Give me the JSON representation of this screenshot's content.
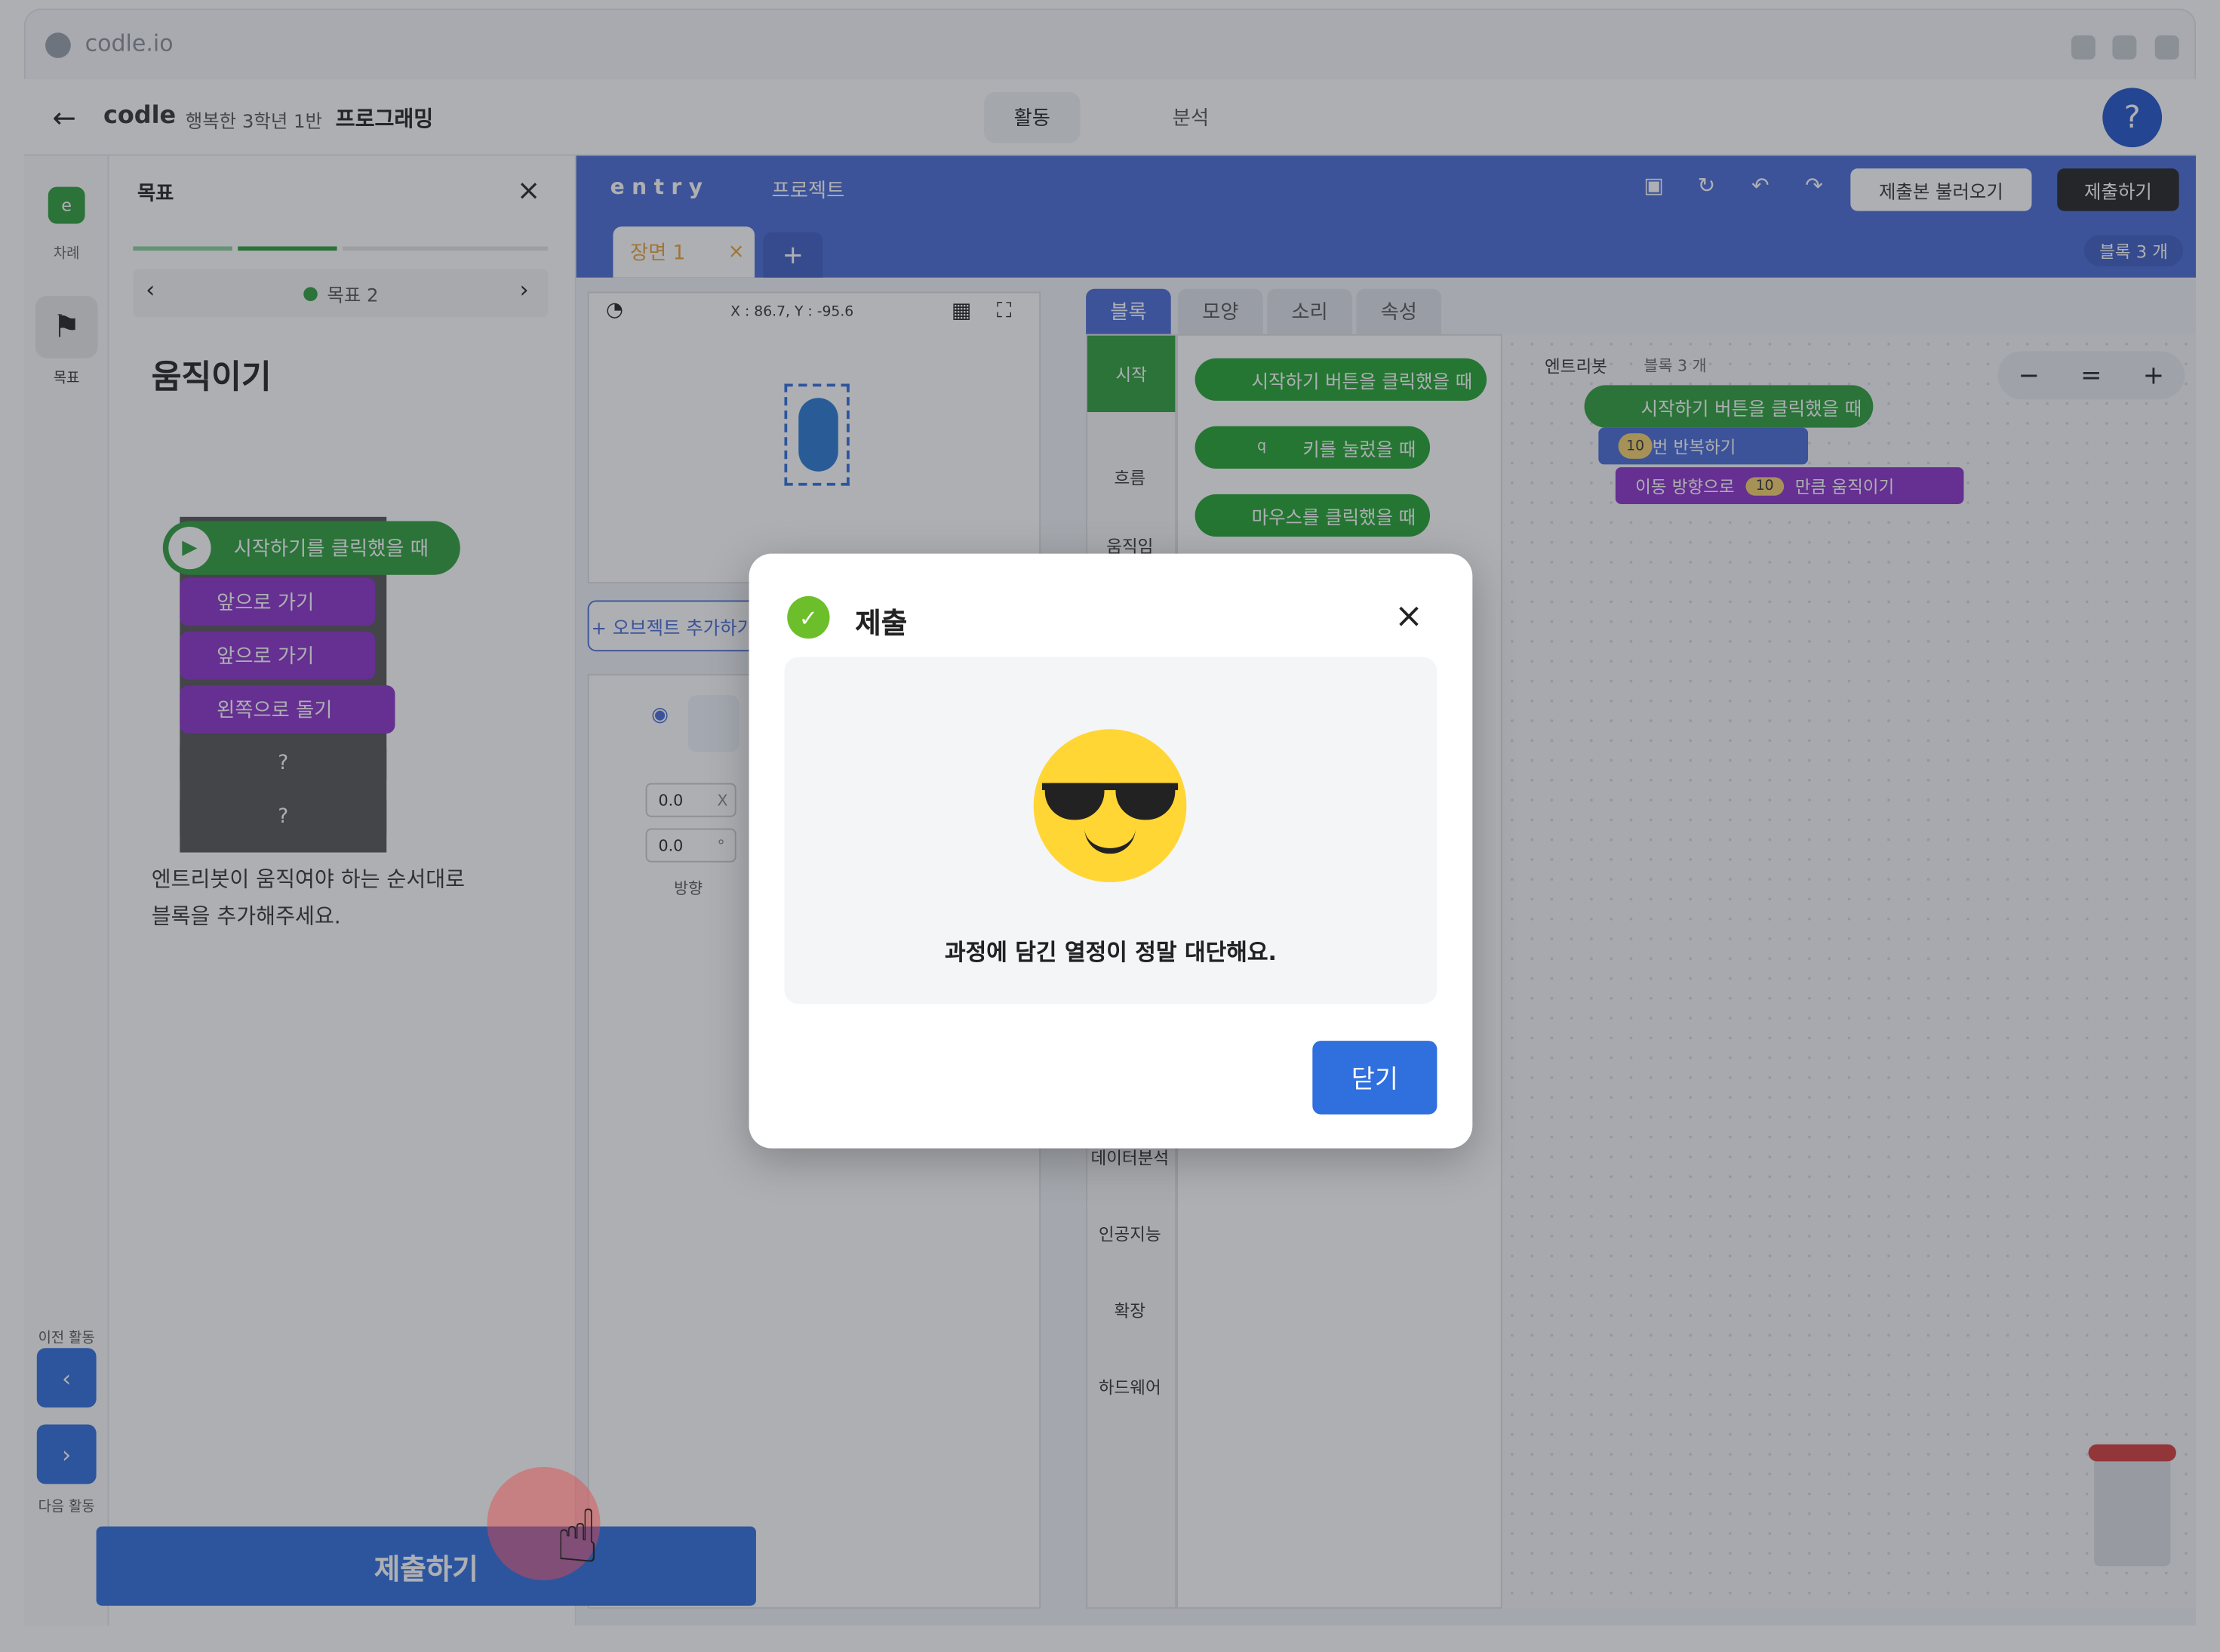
{
  "browser": {
    "url": "codle.io"
  },
  "topbar": {
    "logo": "codle",
    "class_name": "행복한 3학년 1반",
    "subject": "프로그래밍",
    "tabs": [
      {
        "label": "활동"
      },
      {
        "label": "분석"
      }
    ],
    "help": "?"
  },
  "rail": {
    "toc_label": "차례",
    "goal_label": "목표",
    "prev_label": "이전 활동",
    "next_label": "다음 활동"
  },
  "goal_panel": {
    "title": "목표",
    "step_label": "목표 2",
    "heading": "움직이기",
    "blocks": [
      "시작하기를 클릭했을 때",
      "앞으로 가기",
      "앞으로 가기",
      "왼쪽으로 돌기",
      "?",
      "?"
    ],
    "instruction_line1": "엔트리봇이 움직여야 하는 순서대로",
    "instruction_line2": "블록을 추가해주세요.",
    "submit": "제출하기"
  },
  "editor": {
    "logo": "entry",
    "project_label": "프로젝트",
    "load_submission": "제출본 불러오기",
    "submit": "제출하기",
    "scene_tab": "장면 1",
    "add_scene": "+",
    "block_count_badge": "블록 3 개",
    "coords": "X : 86.7, Y : -95.6",
    "add_object": "+ 오브젝트 추가하기",
    "obj_x": "0.0",
    "obj_y": "0.0",
    "x_unit": "X",
    "deg_unit": "°",
    "direction_label": "방향",
    "palette_tabs": [
      "블록",
      "모양",
      "소리",
      "속성"
    ],
    "categories": [
      "시작",
      "흐름",
      "움직임",
      "데이터분석",
      "인공지능",
      "확장",
      "하드웨어"
    ],
    "palette_blocks": [
      "시작하기 버튼을 클릭했을 때",
      "키를 눌렀을 때",
      "마우스를 클릭했을 때"
    ],
    "key_value": "q",
    "script_owner": "엔트리봇",
    "script_count": "블록 3 개",
    "script_blocks": {
      "start": "시작하기 버튼을 클릭했을 때",
      "repeat_count": "10",
      "repeat_label": "번 반복하기",
      "move_pre": "이동 방향으로",
      "move_value": "10",
      "move_post": "만큼 움직이기"
    },
    "zoom": {
      "minus": "−",
      "reset": "=",
      "plus": "+"
    }
  },
  "modal": {
    "title": "제출",
    "message": "과정에 담긴 열정이 정말 대단해요.",
    "close_button": "닫기",
    "close_icon": "×"
  },
  "colors": {
    "accent": "#2f6fde",
    "entry_blue": "#4a6bd6",
    "purple": "#8b33c9",
    "green": "#2e9f3a",
    "success": "#6cbf2a"
  }
}
